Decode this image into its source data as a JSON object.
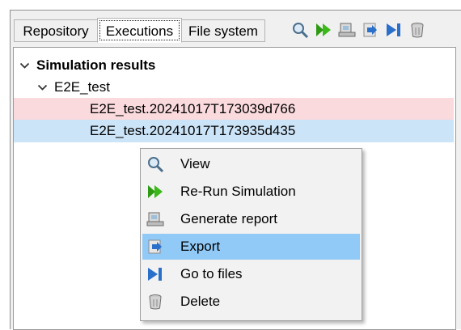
{
  "tabs": [
    {
      "label": "Repository",
      "active": false
    },
    {
      "label": "Executions",
      "active": true
    },
    {
      "label": "File system",
      "active": false
    }
  ],
  "toolbar": {
    "icons": [
      "view-icon",
      "rerun-icon",
      "report-icon",
      "export-icon",
      "go-to-files-icon",
      "delete-icon"
    ]
  },
  "tree": {
    "root_label": "Simulation results",
    "folder_label": "E2E_test",
    "executions": [
      {
        "label": "E2E_test.20241017T173039d766",
        "status": "failed"
      },
      {
        "label": "E2E_test.20241017T173935d435",
        "status": "selected"
      }
    ]
  },
  "context_menu": {
    "items": [
      {
        "label": "View",
        "icon": "view-icon"
      },
      {
        "label": "Re-Run Simulation",
        "icon": "rerun-icon"
      },
      {
        "label": "Generate report",
        "icon": "report-icon"
      },
      {
        "label": "Export",
        "icon": "export-icon",
        "highlighted": true
      },
      {
        "label": "Go to files",
        "icon": "go-to-files-icon"
      },
      {
        "label": "Delete",
        "icon": "delete-icon"
      }
    ]
  },
  "colors": {
    "failed_row": "#fadadd",
    "selected_row": "#cce4f7",
    "menu_highlight": "#91c9f7",
    "run_green": "#2e9a12",
    "export_blue": "#2a6fc9"
  }
}
